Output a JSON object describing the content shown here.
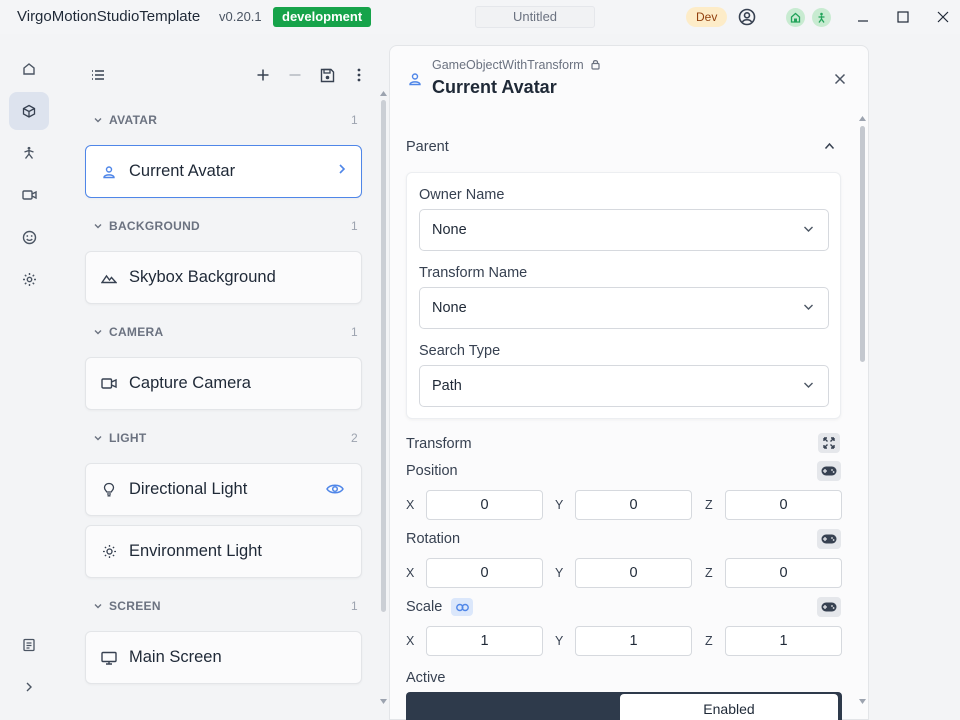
{
  "titlebar": {
    "app_title": "VirgoMotionStudioTemplate",
    "version": "v0.20.1",
    "environment": "development",
    "document_title": "Untitled",
    "mode_badge": "Dev"
  },
  "rail": {
    "items": [
      {
        "icon": "home-icon",
        "active": false
      },
      {
        "icon": "cube-icon",
        "active": true
      },
      {
        "icon": "motion-icon",
        "active": false
      },
      {
        "icon": "video-camera-icon",
        "active": false
      },
      {
        "icon": "smiley-icon",
        "active": false
      },
      {
        "icon": "gear-icon",
        "active": false
      }
    ],
    "bottom_items": [
      {
        "icon": "document-list-icon"
      },
      {
        "icon": "chevron-right-icon"
      }
    ]
  },
  "hierarchy": {
    "categories": [
      {
        "name": "AVATAR",
        "count": "1",
        "items": [
          {
            "label": "Current Avatar",
            "icon": "person-icon",
            "selected": true
          }
        ]
      },
      {
        "name": "BACKGROUND",
        "count": "1",
        "items": [
          {
            "label": "Skybox Background",
            "icon": "mountain-icon"
          }
        ]
      },
      {
        "name": "CAMERA",
        "count": "1",
        "items": [
          {
            "label": "Capture Camera",
            "icon": "video-camera-icon"
          }
        ]
      },
      {
        "name": "LIGHT",
        "count": "2",
        "items": [
          {
            "label": "Directional Light",
            "icon": "lightbulb-icon"
          },
          {
            "label": "Environment Light",
            "icon": "sun-icon"
          }
        ]
      },
      {
        "name": "SCREEN",
        "count": "1",
        "items": [
          {
            "label": "Main Screen",
            "icon": "monitor-icon"
          }
        ]
      }
    ]
  },
  "inspector": {
    "subtitle": "GameObjectWithTransform",
    "title": "Current Avatar",
    "parent_section": "Parent",
    "owner_name_label": "Owner Name",
    "owner_name_value": "None",
    "transform_name_label": "Transform Name",
    "transform_name_value": "None",
    "search_type_label": "Search Type",
    "search_type_value": "Path",
    "transform_section": "Transform",
    "position": {
      "label": "Position",
      "x": "0",
      "y": "0",
      "z": "0"
    },
    "rotation": {
      "label": "Rotation",
      "x": "0",
      "y": "0",
      "z": "0"
    },
    "scale": {
      "label": "Scale",
      "x": "1",
      "y": "1",
      "z": "1"
    },
    "axis_labels": {
      "x": "X",
      "y": "Y",
      "z": "Z"
    },
    "active_label": "Active",
    "active_value": "Enabled"
  },
  "colors": {
    "accent": "#4f86e8",
    "env_badge": "#16a34a",
    "dev_badge": "#fdecc8",
    "toggle_dark": "#2e3a4b"
  }
}
